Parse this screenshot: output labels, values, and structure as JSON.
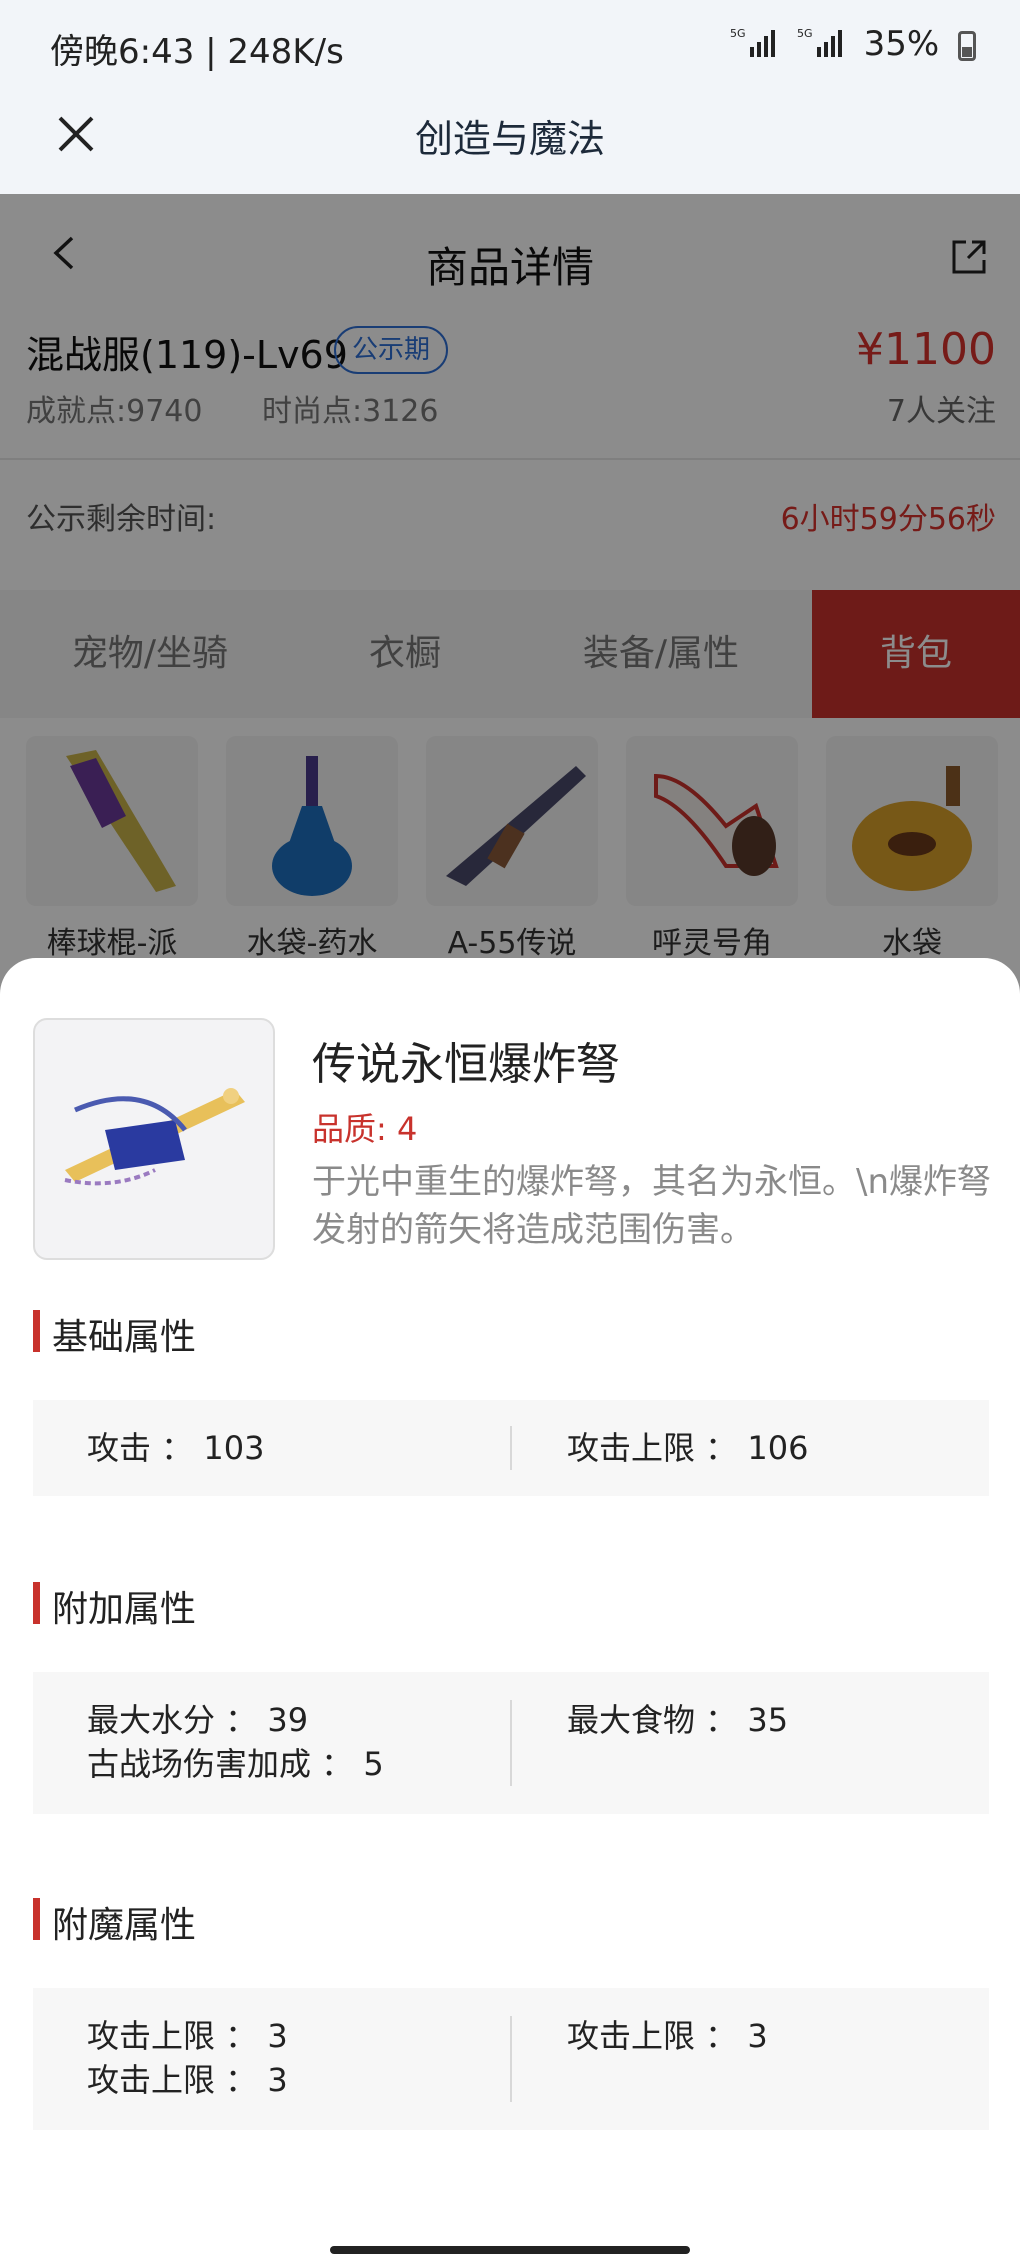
{
  "status_bar": {
    "time": "傍晚6:43 | 248K/s",
    "network": "5G",
    "battery": "35%"
  },
  "titlebar": {
    "title": "创造与魔法"
  },
  "page": {
    "header_title": "商品详情",
    "product_name": "混战服(119)-Lv69",
    "badge": "公示期",
    "price": "¥1100",
    "achievement": "成就点:9740",
    "fashion": "时尚点:3126",
    "followers": "7人关注",
    "remain_label": "公示剩余时间:",
    "remain_value": "6小时59分56秒",
    "tabs": [
      "宠物/坐骑",
      "衣橱",
      "装备/属性",
      "背包"
    ],
    "items": [
      "棒球棍-派",
      "水袋-药水",
      "A-55传说",
      "呼灵号角",
      "水袋"
    ]
  },
  "sheet": {
    "name": "传说永恒爆炸弩",
    "quality": "品质: 4",
    "description": "于光中重生的爆炸弩，其名为永恒。\\n爆炸弩发射的箭矢将造成范围伤害。",
    "sections": [
      {
        "title": "基础属性",
        "left": [
          "攻击 ： 103"
        ],
        "right": [
          "攻击上限 ： 106"
        ]
      },
      {
        "title": "附加属性",
        "left": [
          "最大水分 ： 39",
          "古战场伤害加成 ： 5"
        ],
        "right": [
          "最大食物 ： 35"
        ]
      },
      {
        "title": "附魔属性",
        "left": [
          "攻击上限 ： 3",
          "攻击上限 ： 3"
        ],
        "right": [
          "攻击上限 ： 3"
        ]
      }
    ]
  }
}
